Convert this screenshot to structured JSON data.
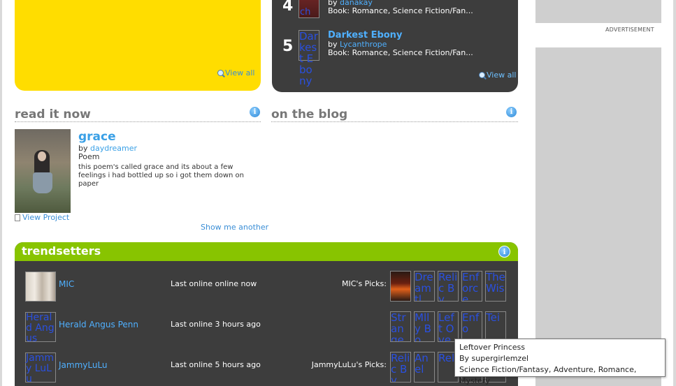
{
  "top_yellow": {
    "view_all": "View all"
  },
  "top_dark": {
    "items": [
      {
        "rank": "4",
        "thumb_alt": "ch",
        "by": "by",
        "author": "danakay",
        "genre": "Book: Romance, Science Fiction/Fan..."
      },
      {
        "rank": "5",
        "thumb_alt": "Darkest Ebony",
        "title": "Darkest Ebony",
        "by": "by",
        "author": "Lycanthrope",
        "genre": "Book: Romance, Science Fiction/Fan..."
      }
    ],
    "view_all": "View all"
  },
  "ads": {
    "label": "ADVERTISEMENT"
  },
  "read_it_now": {
    "heading": "read it now",
    "title": "grace",
    "by": "by",
    "author": "daydreamer",
    "type": "Poem",
    "description": "this poem's called grace and its about a few feelings i had bottled up so i got them down on paper",
    "view_project": "View Project",
    "show_another": "Show me another"
  },
  "on_the_blog": {
    "heading": "on the blog"
  },
  "trendsetters": {
    "heading": "trendsetters",
    "rows": [
      {
        "name": "MIC",
        "avatar_alt": "",
        "last_online": "Last online online now",
        "picks_label": "MIC's Picks:",
        "picks": [
          "",
          "Dreamtl",
          "Relic By",
          "Enforce",
          "The Wis"
        ]
      },
      {
        "name": "Herald Angus Penn",
        "avatar_alt": "Herald Angus",
        "last_online": "Last online 3 hours ago",
        "picks_label": "",
        "picks": [
          "Strange",
          "Mlly Bo",
          "Left Ove",
          "Enfo",
          "Tei"
        ]
      },
      {
        "name": "JammyLuLu",
        "avatar_alt": "Jammy LuLu",
        "last_online": "Last online 5 hours ago",
        "picks_label": "JammyLuLu's Picks:",
        "picks": [
          "Relic By",
          "Anel",
          "Rel",
          "Dre",
          "Wi"
        ]
      }
    ]
  },
  "tooltip": {
    "title": "Leftover Princess",
    "author": "By supergirlemzel",
    "genres": "Science Fiction/Fantasy, Adventure, Romance, Mystery"
  },
  "colors": {
    "accent_green": "#88c400",
    "dark_panel": "#3d3d3d",
    "yellow_panel": "#ffdd00",
    "link_blue": "#3a8ed6"
  }
}
